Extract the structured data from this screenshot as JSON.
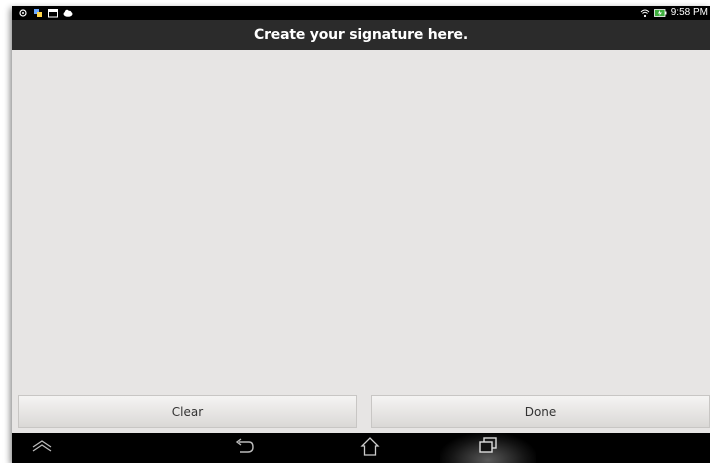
{
  "status_bar": {
    "left_icons": [
      "settings-dot-icon",
      "app-notification-icon",
      "calendar-icon",
      "cloud-icon"
    ],
    "right_icons": [
      "wifi-icon",
      "battery-charging-icon"
    ],
    "time": "9:58 PM"
  },
  "title": "Create your signature here.",
  "buttons": {
    "clear_label": "Clear",
    "done_label": "Done"
  },
  "navigation": {
    "icons": [
      "nav-up-icon",
      "back-icon",
      "home-icon",
      "recent-apps-icon"
    ]
  },
  "colors": {
    "canvas_background": "#e7e5e4",
    "title_bar": "#2b2b2b",
    "status_bar": "#000000"
  }
}
